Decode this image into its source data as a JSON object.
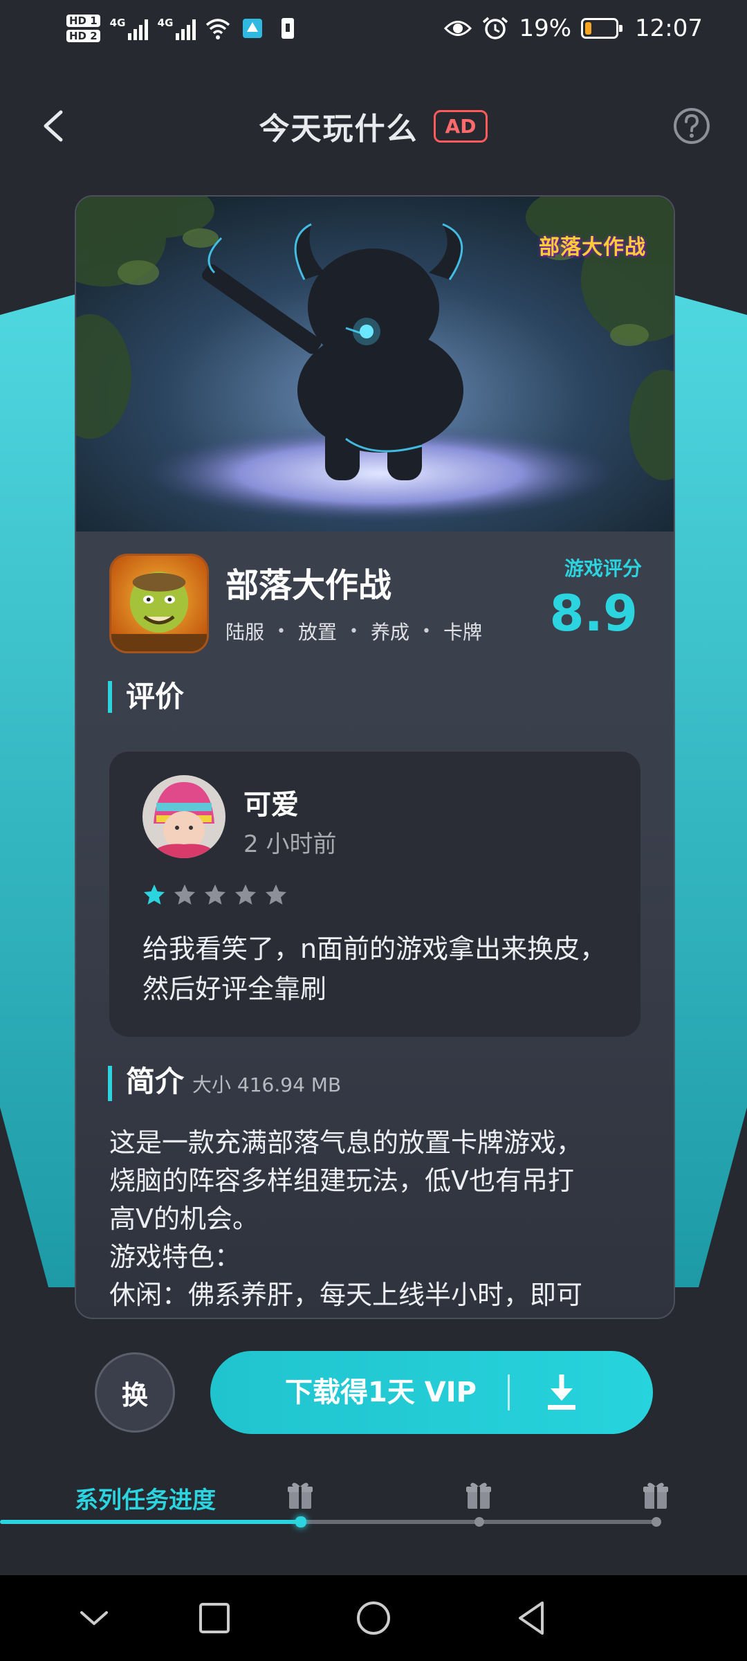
{
  "status_bar": {
    "hd1": "HD 1",
    "hd2": "HD 2",
    "net1": "4G",
    "net2": "4G",
    "battery_percent": "19%",
    "time": "12:07"
  },
  "header": {
    "title": "今天玩什么",
    "ad_badge": "AD"
  },
  "game": {
    "banner_logo": "部落大作战",
    "name": "部落大作战",
    "tags": [
      "陆服",
      "放置",
      "养成",
      "卡牌"
    ],
    "tag_separator": "•",
    "score_label": "游戏评分",
    "score": "8.9"
  },
  "review_section": {
    "title": "评价",
    "review": {
      "user": "可爱",
      "time": "2 小时前",
      "rating": 1,
      "max_rating": 5,
      "text": "给我看笑了，n面前的游戏拿出来换皮，然后好评全靠刷"
    }
  },
  "intro_section": {
    "title": "简介",
    "size": "大小 416.94 MB",
    "text_lines": [
      "这是一款充满部落气息的放置卡牌游戏，",
      "烧脑的阵容多样组建玩法，低V也有吊打",
      "高V的机会。",
      "游戏特色：",
      "休闲：佛系养肝，每天上线半小时，即可"
    ]
  },
  "actions": {
    "swap_label": "换",
    "download_label": "下载得1天 VIP"
  },
  "progress": {
    "label": "系列任务进度",
    "completed_fraction": 0.33,
    "milestones": 3
  },
  "colors": {
    "accent": "#2bd4de",
    "background": "#262930",
    "ad_red": "#ff5b5b"
  },
  "icons": {
    "back": "chevron-left-icon",
    "help": "question-circle-icon",
    "download": "download-icon",
    "gift": "gift-icon",
    "nav_back": "triangle-back-icon",
    "nav_home": "circle-home-icon",
    "nav_recent": "square-recent-icon",
    "nav_collapse": "chevron-down-icon"
  }
}
